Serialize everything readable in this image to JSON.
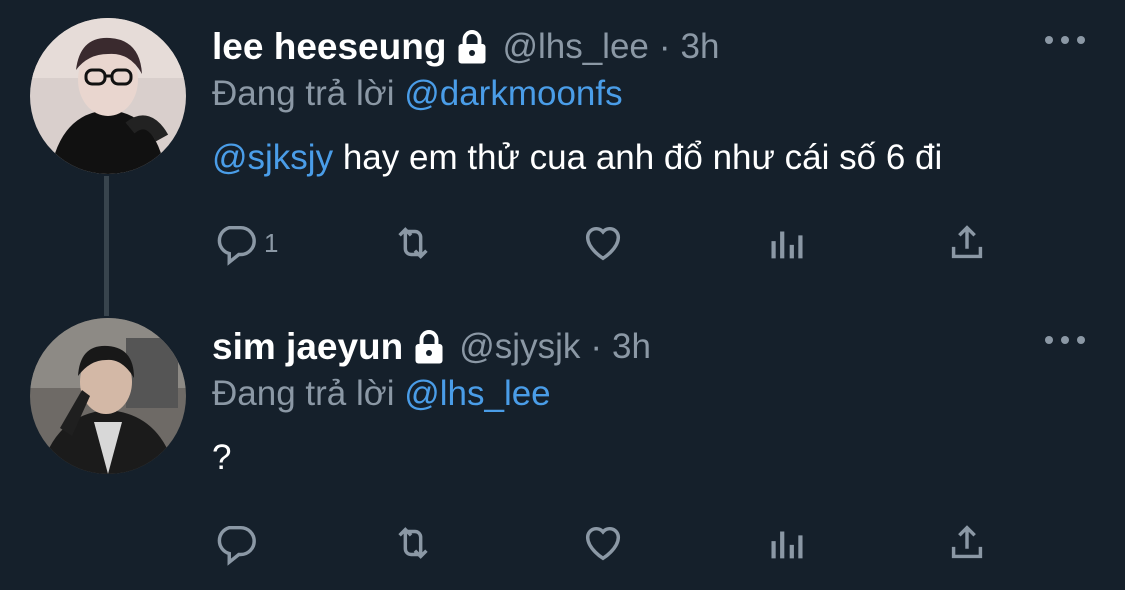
{
  "tweets": [
    {
      "author_name": "lee heeseung",
      "handle": "@lhs_lee",
      "separator": "·",
      "time": "3h",
      "protected": true,
      "reply_prefix": "Đang trả lời",
      "reply_to": "@darkmoonfs",
      "text_mention": "@sjksjy",
      "text_body": " hay em thử cua anh đổ như cái số 6 đi",
      "reply_count": "1"
    },
    {
      "author_name": "sim jaeyun",
      "handle": "@sjysjk",
      "separator": "·",
      "time": "3h",
      "protected": true,
      "reply_prefix": "Đang trả lời",
      "reply_to": "@lhs_lee",
      "text_mention": "",
      "text_body": "?",
      "reply_count": ""
    }
  ],
  "icons": {
    "reply": "reply-icon",
    "retweet": "retweet-icon",
    "like": "heart-icon",
    "views": "analytics-icon",
    "share": "share-icon",
    "more": "more-dots-icon",
    "lock": "lock-icon"
  },
  "colors": {
    "background": "#15202b",
    "mention": "#4a9de8",
    "secondary_text": "#8b98a5",
    "thread_line": "#38444d"
  }
}
